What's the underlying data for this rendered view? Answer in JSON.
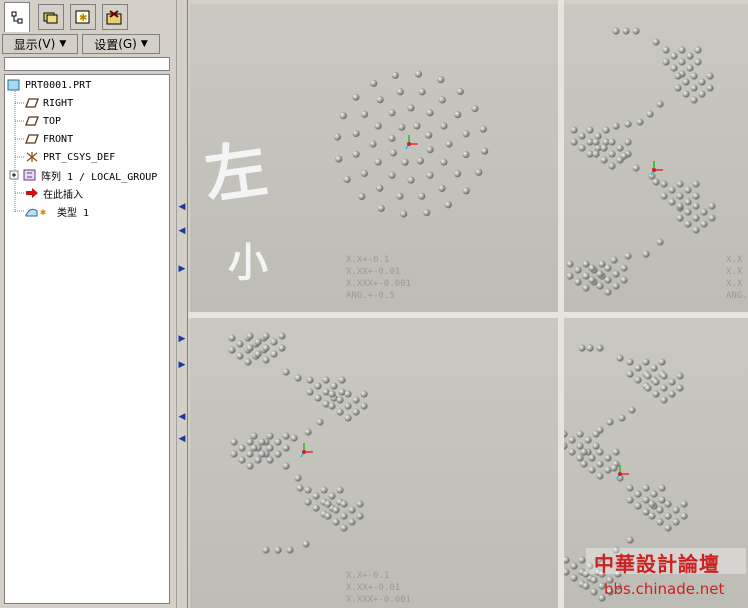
{
  "tabs": [
    {
      "icon": "model-tree-icon"
    },
    {
      "icon": "folder-browser-icon"
    },
    {
      "icon": "favorites-icon"
    },
    {
      "icon": "connections-icon"
    }
  ],
  "toolbar": {
    "show_label": "显示",
    "show_key": "(V)",
    "settings_label": "设置",
    "settings_key": "(G)"
  },
  "tree": {
    "items": [
      {
        "label": "PRT0001.PRT",
        "icon": "part-icon"
      },
      {
        "label": "RIGHT",
        "icon": "datum-plane-icon"
      },
      {
        "label": "TOP",
        "icon": "datum-plane-icon"
      },
      {
        "label": "FRONT",
        "icon": "datum-plane-icon"
      },
      {
        "label": "PRT_CSYS_DEF",
        "icon": "csys-icon"
      },
      {
        "label": "阵列 1 / LOCAL_GROUP",
        "icon": "pattern-icon"
      },
      {
        "label": "在此插入",
        "icon": "insert-arrow-icon"
      },
      {
        "label": "类型 1",
        "icon": "feature-icon"
      }
    ]
  },
  "viewport": {
    "handwriting_top": "左",
    "handwriting_bottom": "小",
    "tolerance_lines": [
      "X.X+-0.1",
      "X.XX+-0.01",
      "X.XXX+-0.001",
      "ANG.+-0.5"
    ],
    "tolerance_lines_short": [
      "X.X",
      "X.X",
      "X.X",
      "ANG."
    ],
    "tolerance_lines_bottom_left": [
      "X.X+-0.1",
      "X.XX+-0.01",
      "X.XXX+-0.001"
    ]
  },
  "watermark": {
    "title": "中華設計論壇",
    "url": "bbs.chinade.net"
  },
  "colors": {
    "panel_bg": "#d4d0c8",
    "viewport_bg": "#c6c5be",
    "ball": "#9a9a96",
    "watermark_red": "#cc2222",
    "splitter_arrow": "#1f3a9c"
  }
}
